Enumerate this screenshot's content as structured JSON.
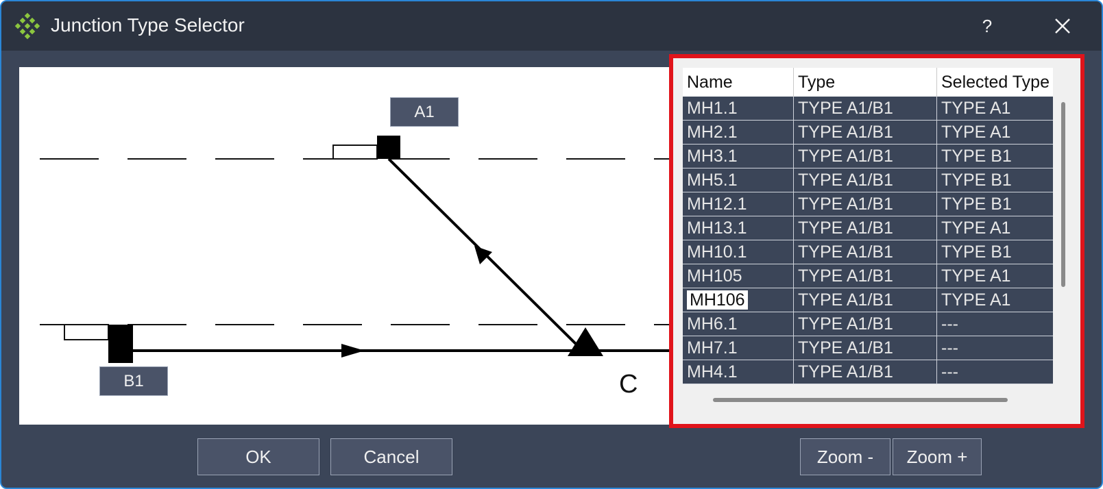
{
  "window": {
    "title": "Junction Type Selector",
    "help_label": "?",
    "accent_color": "#2a86d6"
  },
  "diagram": {
    "labels": {
      "a1": "A1",
      "b1": "B1",
      "c": "C"
    }
  },
  "table": {
    "headers": [
      "Name",
      "Type",
      "Selected Type"
    ],
    "rows": [
      {
        "name": "MH1.1",
        "type": "TYPE A1/B1",
        "selected": "TYPE A1"
      },
      {
        "name": "MH2.1",
        "type": "TYPE A1/B1",
        "selected": "TYPE A1"
      },
      {
        "name": "MH3.1",
        "type": "TYPE A1/B1",
        "selected": "TYPE B1"
      },
      {
        "name": "MH5.1",
        "type": "TYPE A1/B1",
        "selected": "TYPE B1"
      },
      {
        "name": "MH12.1",
        "type": "TYPE A1/B1",
        "selected": "TYPE B1"
      },
      {
        "name": "MH13.1",
        "type": "TYPE A1/B1",
        "selected": "TYPE A1"
      },
      {
        "name": "MH10.1",
        "type": "TYPE A1/B1",
        "selected": "TYPE B1"
      },
      {
        "name": "MH105",
        "type": "TYPE A1/B1",
        "selected": "TYPE A1"
      },
      {
        "name": "MH106",
        "type": "TYPE A1/B1",
        "selected": "TYPE A1"
      },
      {
        "name": "MH6.1",
        "type": "TYPE A1/B1",
        "selected": "---"
      },
      {
        "name": "MH7.1",
        "type": "TYPE A1/B1",
        "selected": "---"
      },
      {
        "name": "MH4.1",
        "type": "TYPE A1/B1",
        "selected": "---"
      }
    ],
    "highlight_color": "#e0141b"
  },
  "buttons": {
    "ok": "OK",
    "cancel": "Cancel",
    "zoom_out": "Zoom -",
    "zoom_in": "Zoom +"
  }
}
